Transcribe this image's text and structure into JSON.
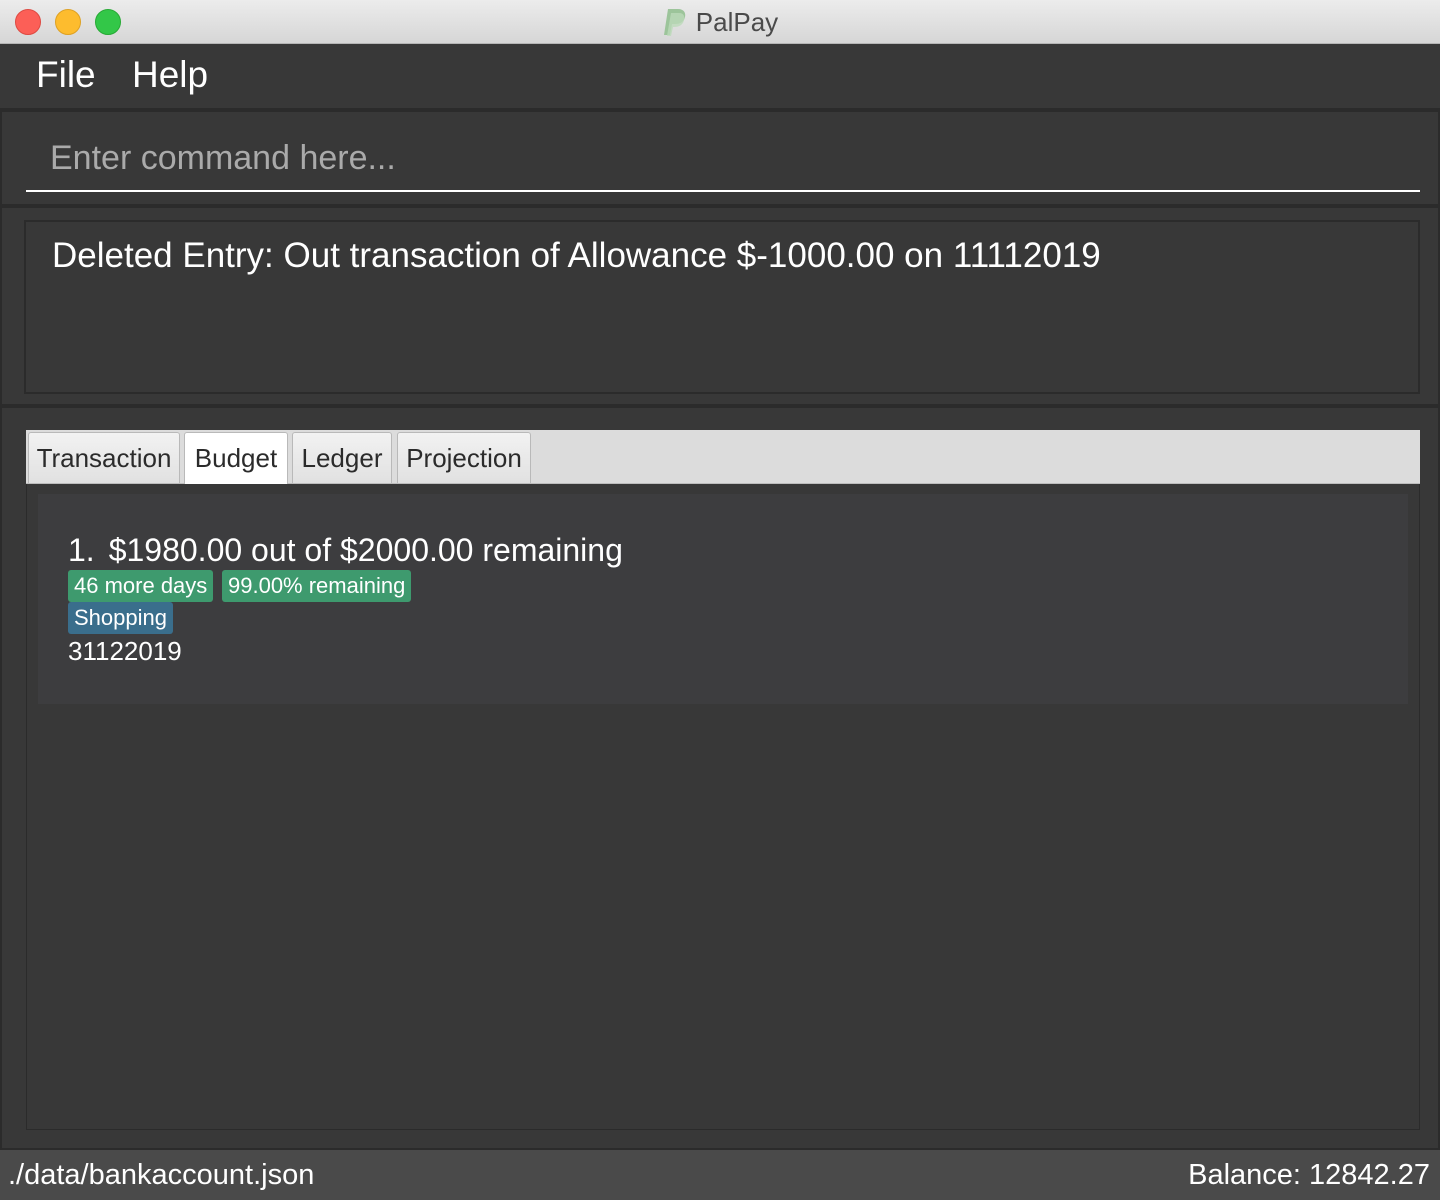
{
  "window": {
    "title": "PalPay",
    "logo_icon": "paypal-logo-icon"
  },
  "menu": {
    "file": "File",
    "help": "Help"
  },
  "command": {
    "value": "",
    "placeholder": "Enter command here..."
  },
  "result": {
    "text": "Deleted Entry: Out transaction of Allowance $-1000.00 on 11112019"
  },
  "tabs": [
    {
      "label": "Transaction",
      "selected": false
    },
    {
      "label": "Budget",
      "selected": true
    },
    {
      "label": "Ledger",
      "selected": false
    },
    {
      "label": "Projection",
      "selected": false
    }
  ],
  "budgets": [
    {
      "index": "1.",
      "summary": "$1980.00 out of $2000.00 remaining",
      "days_left": "46 more days",
      "percent_remaining": "99.00% remaining",
      "category": "Shopping",
      "date": "31122019"
    }
  ],
  "status": {
    "file_path": "./data/bankaccount.json",
    "balance": "Balance: 12842.27"
  },
  "colors": {
    "background": "#383838",
    "badge_green": "#3e9a6e",
    "badge_blue": "#3a6e8c",
    "status_bar": "#4a4a4a"
  }
}
